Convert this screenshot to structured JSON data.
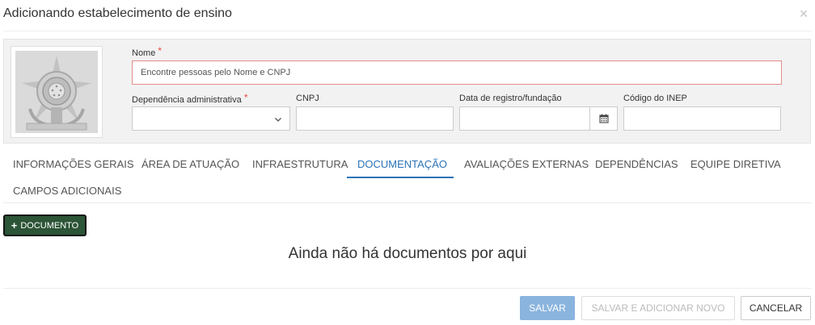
{
  "modal": {
    "title": "Adicionando estabelecimento de ensino",
    "close_label": "×"
  },
  "form": {
    "nome_label": "Nome",
    "nome_placeholder": "Encontre pessoas pelo Nome e CNPJ",
    "nome_value": "",
    "dependencia_label": "Dependência administrativa",
    "dependencia_value": "",
    "cnpj_label": "CNPJ",
    "cnpj_value": "",
    "data_label": "Data de registro/fundação",
    "data_value": "",
    "inep_label": "Código do INEP",
    "inep_value": "",
    "required_mark": "*"
  },
  "tabs": [
    {
      "label": "INFORMAÇÕES GERAIS",
      "active": false
    },
    {
      "label": "ÁREA DE ATUAÇÃO",
      "active": false
    },
    {
      "label": "INFRAESTRUTURA",
      "active": false
    },
    {
      "label": "DOCUMENTAÇÃO",
      "active": true
    },
    {
      "label": "AVALIAÇÕES EXTERNAS",
      "active": false
    },
    {
      "label": "DEPENDÊNCIAS",
      "active": false
    },
    {
      "label": "EQUIPE DIRETIVA",
      "active": false
    },
    {
      "label": "CAMPOS ADICIONAIS",
      "active": false
    }
  ],
  "documents": {
    "add_button_label": "DOCUMENTO",
    "add_button_icon": "+",
    "empty_message": "Ainda não há documentos por aqui"
  },
  "footer": {
    "save_label": "SALVAR",
    "save_new_label": "SALVAR E ADICIONAR NOVO",
    "cancel_label": "CANCELAR"
  },
  "colors": {
    "accent": "#2c73b7",
    "required": "#e74c3c",
    "add_button_bg": "#2c5436",
    "save_button_bg": "#8ab4de"
  }
}
